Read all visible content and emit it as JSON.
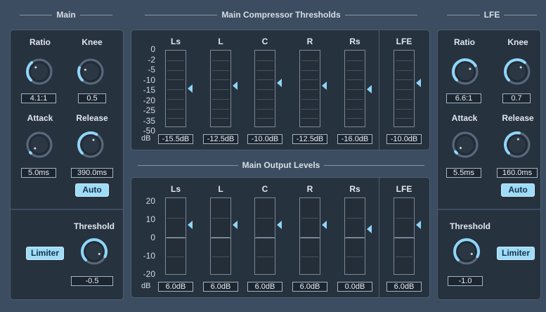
{
  "headers": {
    "main": "Main",
    "thresholds": "Main Compressor Thresholds",
    "lfe": "LFE",
    "output": "Main Output Levels"
  },
  "main": {
    "ratio": {
      "label": "Ratio",
      "value": "4.1:1"
    },
    "knee": {
      "label": "Knee",
      "value": "0.5"
    },
    "attack": {
      "label": "Attack",
      "value": "5.0ms"
    },
    "release": {
      "label": "Release",
      "value": "390.0ms"
    },
    "auto_label": "Auto",
    "limiter_label": "Limiter",
    "threshold": {
      "label": "Threshold",
      "value": "-0.5"
    }
  },
  "lfe": {
    "ratio": {
      "label": "Ratio",
      "value": "6.6:1"
    },
    "knee": {
      "label": "Knee",
      "value": "0.7"
    },
    "attack": {
      "label": "Attack",
      "value": "5.5ms"
    },
    "release": {
      "label": "Release",
      "value": "160.0ms"
    },
    "auto_label": "Auto",
    "limiter_label": "Limiter",
    "threshold": {
      "label": "Threshold",
      "value": "-1.0"
    }
  },
  "thresholds": {
    "unit": "dB",
    "scale": [
      "0",
      "-2",
      "-5",
      "-10",
      "-15",
      "-20",
      "-25",
      "-35",
      "-50"
    ],
    "channels": [
      {
        "name": "Ls",
        "value": "-15.5dB"
      },
      {
        "name": "L",
        "value": "-12.5dB"
      },
      {
        "name": "C",
        "value": "-10.0dB"
      },
      {
        "name": "R",
        "value": "-12.5dB"
      },
      {
        "name": "Rs",
        "value": "-16.0dB"
      },
      {
        "name": "LFE",
        "value": "-10.0dB"
      }
    ]
  },
  "output": {
    "unit": "dB",
    "scale": [
      "20",
      "10",
      "0",
      "-10",
      "-20"
    ],
    "channels": [
      {
        "name": "Ls",
        "value": "6.0dB"
      },
      {
        "name": "L",
        "value": "6.0dB"
      },
      {
        "name": "C",
        "value": "6.0dB"
      },
      {
        "name": "R",
        "value": "6.0dB"
      },
      {
        "name": "Rs",
        "value": "0.0dB"
      },
      {
        "name": "LFE",
        "value": "6.0dB"
      }
    ]
  }
}
